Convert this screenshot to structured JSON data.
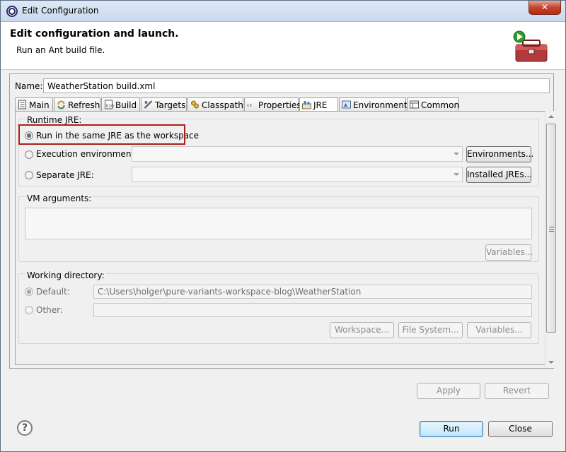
{
  "window": {
    "title": "Edit Configuration"
  },
  "header": {
    "title": "Edit configuration and launch.",
    "subtitle": "Run an Ant build file."
  },
  "name": {
    "label": "Name:",
    "value": "WeatherStation build.xml"
  },
  "tabs": [
    {
      "label": "Main",
      "icon": "main-icon",
      "active": false
    },
    {
      "label": "Refresh",
      "icon": "refresh-icon",
      "active": false
    },
    {
      "label": "Build",
      "icon": "build-icon",
      "active": false
    },
    {
      "label": "Targets",
      "icon": "targets-icon",
      "active": false
    },
    {
      "label": "Classpath",
      "icon": "classpath-icon",
      "active": false
    },
    {
      "label": "Properties",
      "icon": "properties-icon",
      "active": false
    },
    {
      "label": "JRE",
      "icon": "jre-icon",
      "active": true
    },
    {
      "label": "Environment",
      "icon": "environment-icon",
      "active": false
    },
    {
      "label": "Common",
      "icon": "common-icon",
      "active": false
    }
  ],
  "runtime_jre": {
    "group_label": "Runtime JRE:",
    "options": [
      {
        "label": "Run in the same JRE as the workspace",
        "checked": true
      },
      {
        "label": "Execution environment:",
        "checked": false
      },
      {
        "label": "Separate JRE:",
        "checked": false
      }
    ],
    "execution_env_value": "",
    "separate_jre_value": "",
    "environments_button": "Environments...",
    "installed_jres_button": "Installed JREs..."
  },
  "vm_arguments": {
    "group_label": "VM arguments:",
    "value": "",
    "variables_button": "Variables..."
  },
  "working_directory": {
    "group_label": "Working directory:",
    "default_label": "Default:",
    "default_value": "C:\\Users\\holger\\pure-variants-workspace-blog\\WeatherStation",
    "other_label": "Other:",
    "other_value": "",
    "workspace_button": "Workspace...",
    "file_system_button": "File System...",
    "variables_button": "Variables..."
  },
  "footer": {
    "apply_button": "Apply",
    "revert_button": "Revert",
    "run_button": "Run",
    "close_button": "Close",
    "help_glyph": "?"
  },
  "colors": {
    "highlight_border": "#a8201b",
    "title_close": "#c7432d",
    "default_button": "#3c7fb1"
  }
}
